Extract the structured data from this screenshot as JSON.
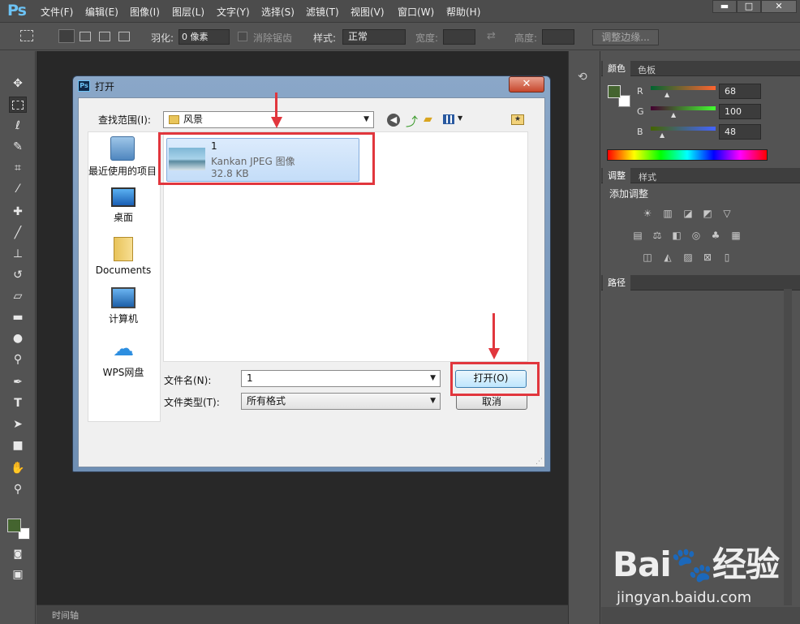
{
  "app": {
    "logo": "Ps"
  },
  "menu": [
    "文件(F)",
    "编辑(E)",
    "图像(I)",
    "图层(L)",
    "文字(Y)",
    "选择(S)",
    "滤镜(T)",
    "视图(V)",
    "窗口(W)",
    "帮助(H)"
  ],
  "window_controls": {
    "minimize": "▬",
    "maximize": "□",
    "close": "✕"
  },
  "options": {
    "feather_label": "羽化:",
    "feather_value": "0 像素",
    "antialias_label": "消除锯齿",
    "style_label": "样式:",
    "style_value": "正常",
    "width_label": "宽度:",
    "height_label": "高度:",
    "refine_edge": "调整边缘..."
  },
  "color_panel": {
    "tabs": [
      "颜色",
      "色板"
    ],
    "r_label": "R",
    "r_value": "68",
    "g_label": "G",
    "g_value": "100",
    "b_label": "B",
    "b_value": "48",
    "foreground": "#44642f"
  },
  "adjust_panel": {
    "tabs": [
      "调整",
      "样式"
    ],
    "title": "添加调整"
  },
  "paths_panel": {
    "tab": "路径"
  },
  "timeline": {
    "label": "时间轴"
  },
  "dialog": {
    "title": "打开",
    "close": "✕",
    "lookin_label": "查找范围(I):",
    "lookin_value": "风景",
    "places": [
      "最近使用的项目",
      "桌面",
      "Documents",
      "计算机",
      "WPS网盘"
    ],
    "file": {
      "name": "1",
      "type": "Kankan JPEG 图像",
      "size": "32.8 KB"
    },
    "filename_label": "文件名(N):",
    "filename_value": "1",
    "filetype_label": "文件类型(T):",
    "filetype_value": "所有格式",
    "open_button": "打开(O)",
    "cancel_button": "取消"
  },
  "watermark": {
    "brand": "Bai🐾经验",
    "url": "jingyan.baidu.com"
  }
}
